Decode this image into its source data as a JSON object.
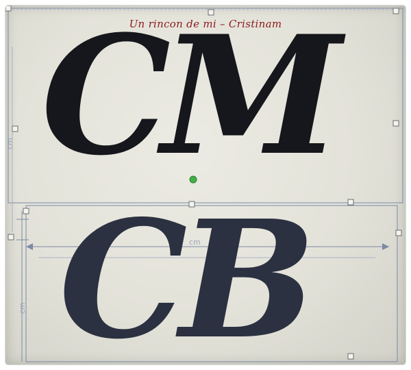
{
  "watermark": {
    "text": "Un rincon de mi – Cristinam"
  },
  "monogram_top": {
    "letter_1": "C",
    "letter_2": "M"
  },
  "monogram_bottom": {
    "letter_1": "C",
    "letter_2": "B"
  },
  "dimension_labels": {
    "horizontal": "cm",
    "vertical_left_top": "cm",
    "vertical_left_bottom": "cm"
  },
  "colors": {
    "text_ink": "#16171c",
    "watermark": "#8b1a1a",
    "guides": "#7c8aa6",
    "rotate_handle": "#42b045"
  },
  "icons": [
    "rotate-handle-icon",
    "resize-handle-icon"
  ]
}
